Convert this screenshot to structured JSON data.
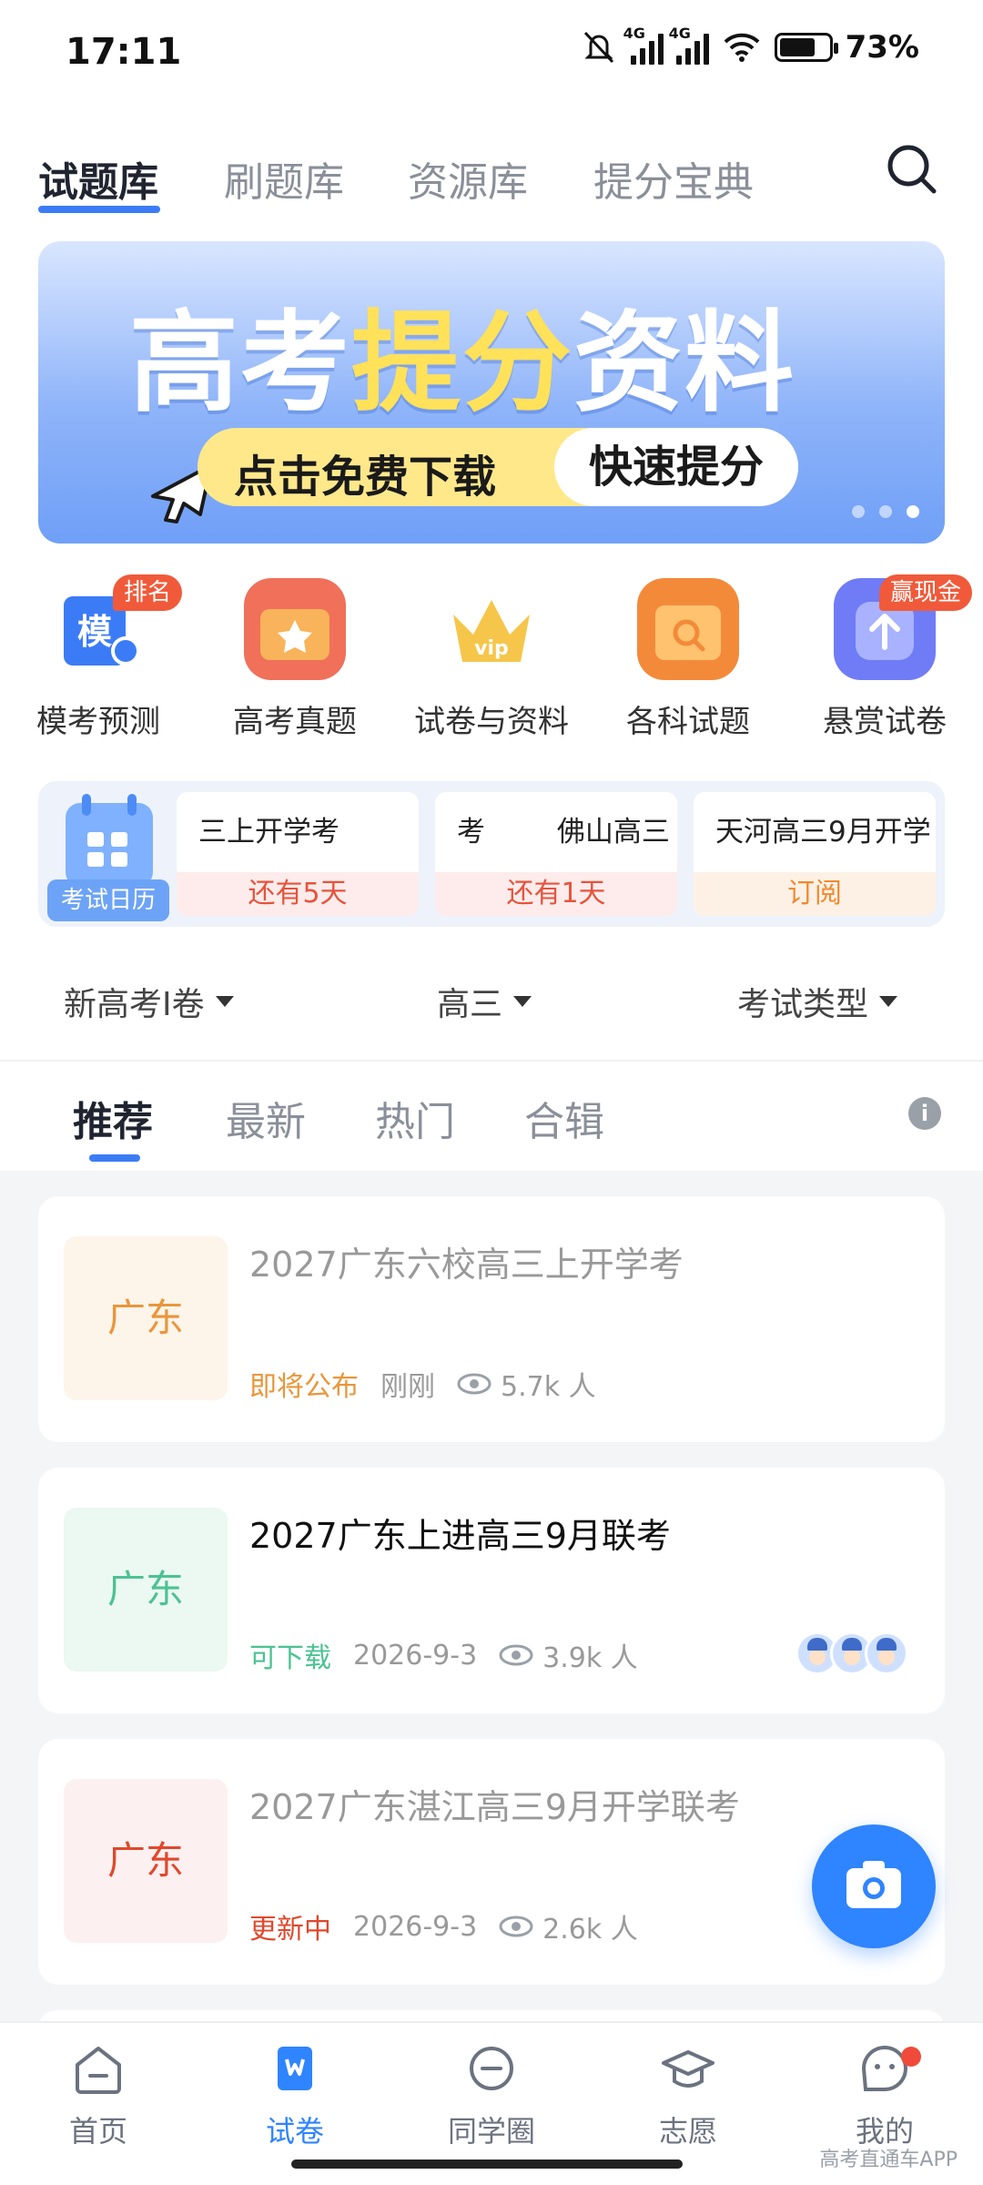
{
  "status": {
    "time": "17:11",
    "battery": "73%",
    "network_tag_1": "4G",
    "network_tag_2": "4G"
  },
  "top_tabs": [
    "试题库",
    "刷题库",
    "资源库",
    "提分宝典"
  ],
  "banner": {
    "title_part1": "高考",
    "title_highlight": "提分",
    "title_part2": "资料",
    "pill_left": "点击免费下载",
    "pill_right": "快速提分"
  },
  "quick_items": [
    {
      "label": "模考预测",
      "badge": "排名",
      "icon_char": "模",
      "color": "#3b7cf6"
    },
    {
      "label": "高考真题",
      "badge": "",
      "color": "#f0705a"
    },
    {
      "label": "试卷与资料",
      "badge": "",
      "icon_char": "vip",
      "color": "#f5c64a"
    },
    {
      "label": "各科试题",
      "badge": "",
      "color": "#f38a3a"
    },
    {
      "label": "悬赏试卷",
      "badge": "赢现金",
      "color": "#6f7cf6"
    }
  ],
  "calendar": {
    "label": "考试日历",
    "cards": [
      {
        "title": "三上开学考",
        "status": "还有5天"
      },
      {
        "title": "考        佛山高三",
        "status": "还有1天"
      },
      {
        "title": "天河高三9月开学",
        "status": "订阅"
      }
    ]
  },
  "filters": [
    "新高考Ⅰ卷",
    "高三",
    "考试类型"
  ],
  "section_tabs": [
    "推荐",
    "最新",
    "热门",
    "合辑"
  ],
  "cards": [
    {
      "region": "广东",
      "title": "2027广东六校高三上开学考",
      "status": "即将公布",
      "date": "刚刚",
      "views": "5.7k 人"
    },
    {
      "region": "广东",
      "title": "2027广东上进高三9月联考",
      "status": "可下载",
      "date": "2026-9-3",
      "views": "3.9k 人"
    },
    {
      "region": "广东",
      "title": "2027广东湛江高三9月开学联考",
      "status": "更新中",
      "date": "2026-9-3",
      "views": "2.6k 人"
    }
  ],
  "colors": {
    "accent": "#2f84ff",
    "orange": "#e9963a",
    "green": "#4cc293",
    "red": "#e0482c"
  },
  "bottom_nav": [
    "首页",
    "试卷",
    "同学圈",
    "志愿",
    "我的"
  ],
  "watermark": "高考直通车APP"
}
